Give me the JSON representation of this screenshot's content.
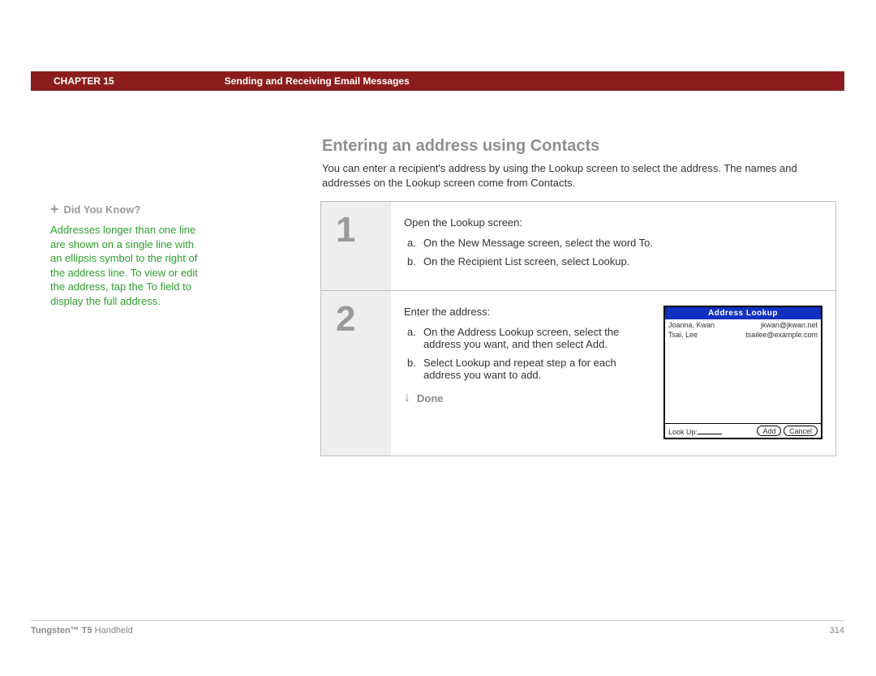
{
  "header": {
    "chapter": "CHAPTER 15",
    "title": "Sending and Receiving Email Messages"
  },
  "section_title": "Entering an address using Contacts",
  "intro": "You can enter a recipient's address by using the Lookup screen to select the address. The names and addresses on the Lookup screen come from Contacts.",
  "sidebar": {
    "heading": "Did You Know?",
    "body": "Addresses longer than one line are shown on a single line with an ellipsis symbol to the right of the address line. To view or edit the address, tap the To field to display the full address."
  },
  "steps": [
    {
      "num": "1",
      "lead": "Open the Lookup screen:",
      "subs": [
        {
          "l": "a.",
          "t": "On the New Message screen, select the word To."
        },
        {
          "l": "b.",
          "t": "On the Recipient List screen, select Lookup."
        }
      ]
    },
    {
      "num": "2",
      "lead": "Enter the address:",
      "subs": [
        {
          "l": "a.",
          "t": "On the Address Lookup screen, select the address you want, and then select Add."
        },
        {
          "l": "b.",
          "t": "Select Lookup and repeat step a for each address you want to add."
        }
      ]
    }
  ],
  "done_label": "Done",
  "screenshot": {
    "title": "Address Lookup",
    "rows": [
      {
        "name": "Joanna, Kwan",
        "email": "jkwan@jkwan.net"
      },
      {
        "name": "Tsai, Lee",
        "email": "tsailee@example.com"
      }
    ],
    "lookup_label": "Look Up:",
    "add": "Add",
    "cancel": "Cancel"
  },
  "footer": {
    "left_bold": "Tungsten™ T5",
    "left_rest": " Handheld",
    "page": "314"
  }
}
